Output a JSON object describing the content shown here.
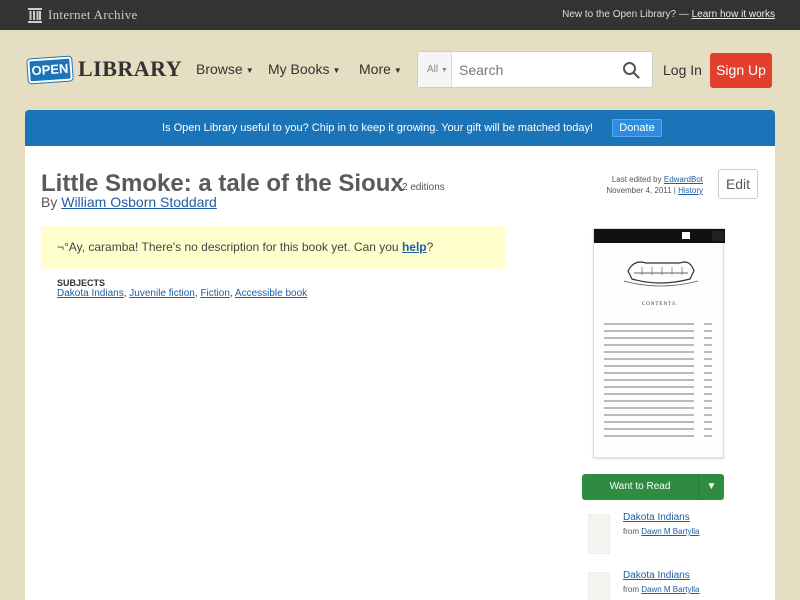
{
  "topbar": {
    "brand": "Internet Archive",
    "prompt": "New to the Open Library? —",
    "learn_link": "Learn how it works"
  },
  "header": {
    "logo_open": "OPEN",
    "logo_library": "LIBRARY",
    "nav": [
      {
        "label": "Browse"
      },
      {
        "label": "My Books"
      },
      {
        "label": "More"
      }
    ],
    "search_scope": "All",
    "search_placeholder": "Search",
    "login_label": "Log In",
    "signup_label": "Sign Up"
  },
  "donate": {
    "message": "Is Open Library useful to you? Chip in to keep it growing. Your gift will be matched today!",
    "button": "Donate"
  },
  "book": {
    "title": "Little Smoke: a tale of the Sioux",
    "editions": "2 editions",
    "by": "By",
    "author": "William Osborn Stoddard",
    "last_edited_prefix": "Last edited by",
    "last_edited_by": "EdwardBot",
    "last_edited_date": "November 4, 2011 |",
    "history_link": "History",
    "edit_label": "Edit",
    "description_prefix": "¬°Ay, caramba! There's no description for this book yet. Can you",
    "description_link": "help",
    "description_suffix": "?",
    "subjects_heading": "SUBJECTS",
    "subjects": [
      "Dakota Indians",
      "Juvenile fiction",
      "Fiction",
      "Accessible book"
    ]
  },
  "cover": {
    "heading": "CONTENTS."
  },
  "want_to_read": {
    "label": "Want to Read"
  },
  "related": [
    {
      "title": "Dakota Indians",
      "from": "from",
      "author": "Dawn M Bartylla"
    },
    {
      "title": "Dakota Indians",
      "from": "from",
      "author": "Dawn M Bartylla"
    }
  ],
  "colors": {
    "background": "#e6dec3",
    "brand_blue": "#1c74b8",
    "signup_red": "#e2402d",
    "want_green": "#2e8b40",
    "link": "#1d5ea6"
  }
}
